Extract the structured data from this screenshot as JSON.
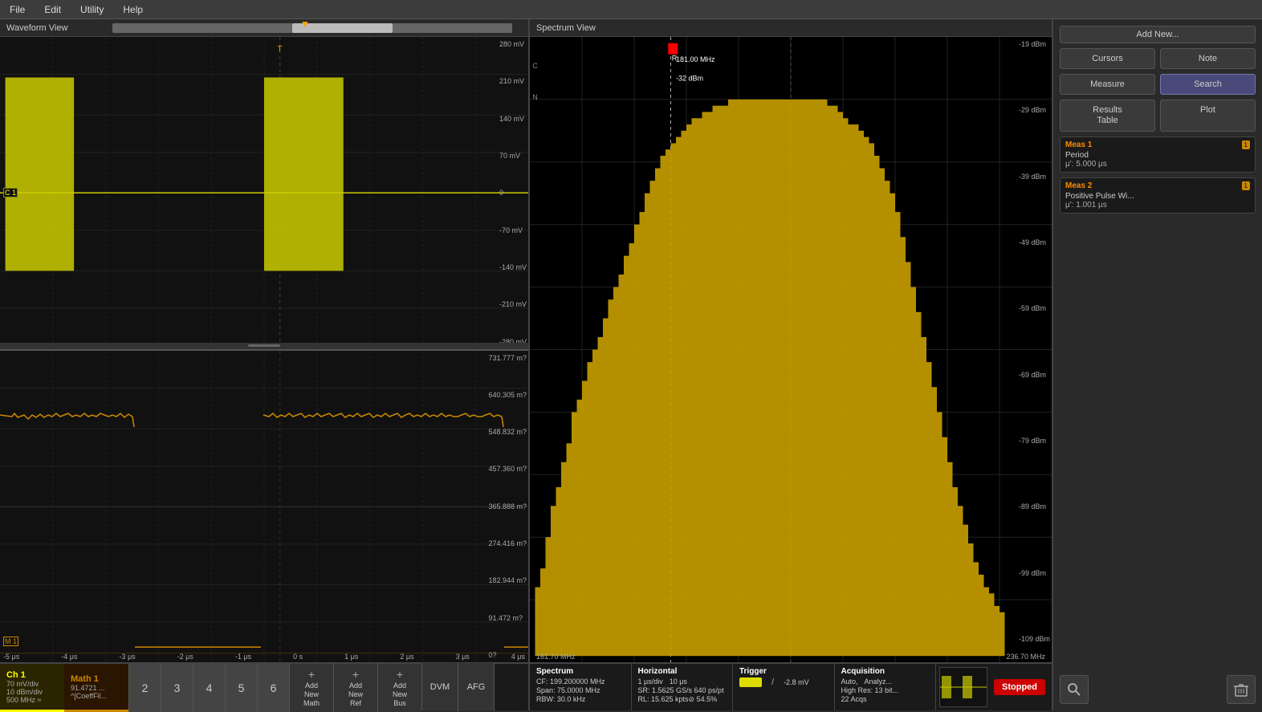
{
  "menu": {
    "items": [
      "File",
      "Edit",
      "Utility",
      "Help"
    ]
  },
  "waveform_view": {
    "title": "Waveform View"
  },
  "spectrum_view": {
    "title": "Spectrum View"
  },
  "waveform_upper": {
    "scale_labels": [
      "280 mV",
      "210 mV",
      "140 mV",
      "70 mV",
      "0",
      "-70 mV",
      "-140 mV",
      "-210 mV",
      "-280 mV"
    ]
  },
  "waveform_lower": {
    "scale_labels": [
      "731.777 m?",
      "640.305 m?",
      "548.832 m?",
      "457.360 m?",
      "365.888 m?",
      "274.416 m?",
      "182.944 m?",
      "91.472 m?",
      "0?"
    ]
  },
  "time_labels": [
    "-5 μs",
    "-4 μs",
    "-3 μs",
    "-2 μs",
    "-1 μs",
    "0 s",
    "1 μs",
    "2 μs",
    "3 μs",
    "4 μs"
  ],
  "spectrum_scale": {
    "db_labels": [
      "-19 dBm",
      "-29 dBm",
      "-39 dBm",
      "-49 dBm",
      "-59 dBm",
      "-69 dBm",
      "-79 dBm",
      "-89 dBm",
      "-99 dBm",
      "-109 dBm"
    ],
    "freq_start": "161.70 MHz",
    "freq_end": "236.70 MHz"
  },
  "cursor": {
    "r_label": "R",
    "r_freq": "181.00 MHz",
    "r_level": "-32 dBm",
    "c_label": "C",
    "n_label": "N"
  },
  "right_panel": {
    "add_new": "Add New...",
    "cursors": "Cursors",
    "note": "Note",
    "measure": "Measure",
    "search": "Search",
    "results_table": "Results\nTable",
    "plot": "Plot"
  },
  "meas1": {
    "title": "Meas 1",
    "badge": "1",
    "name": "Period",
    "value": "μ': 5.000 μs"
  },
  "meas2": {
    "title": "Meas 2",
    "badge": "1",
    "name": "Positive Pulse Wi...",
    "value": "μ': 1.001 μs"
  },
  "bottom_bar": {
    "ch1_label": "Ch 1",
    "ch1_scale": "70 mV/div",
    "ch1_dbdiv": "10 dBm/div",
    "ch1_freq": "500 MHz ≈",
    "math1_label": "Math 1",
    "math1_val1": "91.4721 ...",
    "math1_val2": "^[CoeffFil...",
    "channels": [
      "2",
      "3",
      "4",
      "5",
      "6"
    ],
    "add_math": "Add\nNew\nMath",
    "add_ref": "Add\nNew\nRef",
    "add_bus": "Add\nNew\nBus",
    "dvm": "DVM",
    "afg": "AFG"
  },
  "spectrum_status": {
    "title": "Spectrum",
    "cf": "CF: 199.200000 MHz",
    "span": "Span: 75.0000 MHz",
    "rbw": "RBW: 30.0 kHz"
  },
  "horizontal_status": {
    "title": "Horizontal",
    "scale": "1 μs/div",
    "delay": "10 μs",
    "sr": "SR: 1.5625 GS/s 640 ps/pt",
    "rl": "RL: 15.625 kpts⊘ 54.5%"
  },
  "trigger_status": {
    "title": "Trigger",
    "level": "-2.8 mV"
  },
  "acquisition_status": {
    "title": "Acquisition",
    "mode": "Auto,",
    "analyze": "Analyz...",
    "highres": "High Res: 13 bit...",
    "acqs": "22 Acqs"
  },
  "stopped_btn": "Stopped",
  "bottom_icons": {
    "zoom": "🔍",
    "trash": "🗑"
  }
}
